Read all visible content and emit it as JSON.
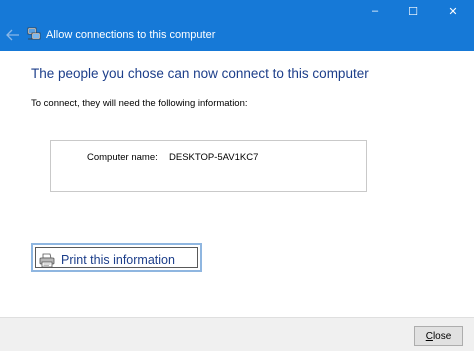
{
  "window": {
    "title": "Allow connections to this computer",
    "controls": {
      "minimize": "–",
      "maximize": "☐",
      "close": "✕"
    }
  },
  "main": {
    "heading": "The people you chose can now connect to this computer",
    "instruction": "To connect, they will need the following information:",
    "info": {
      "computer_name_label": "Computer name:",
      "computer_name_value": "DESKTOP-5AV1KC7"
    },
    "print_button_label": "Print this information"
  },
  "footer": {
    "close_mnemonic": "C",
    "close_rest": "lose"
  },
  "colors": {
    "titlebar": "#1679d7",
    "heading": "#1c3e8a"
  }
}
